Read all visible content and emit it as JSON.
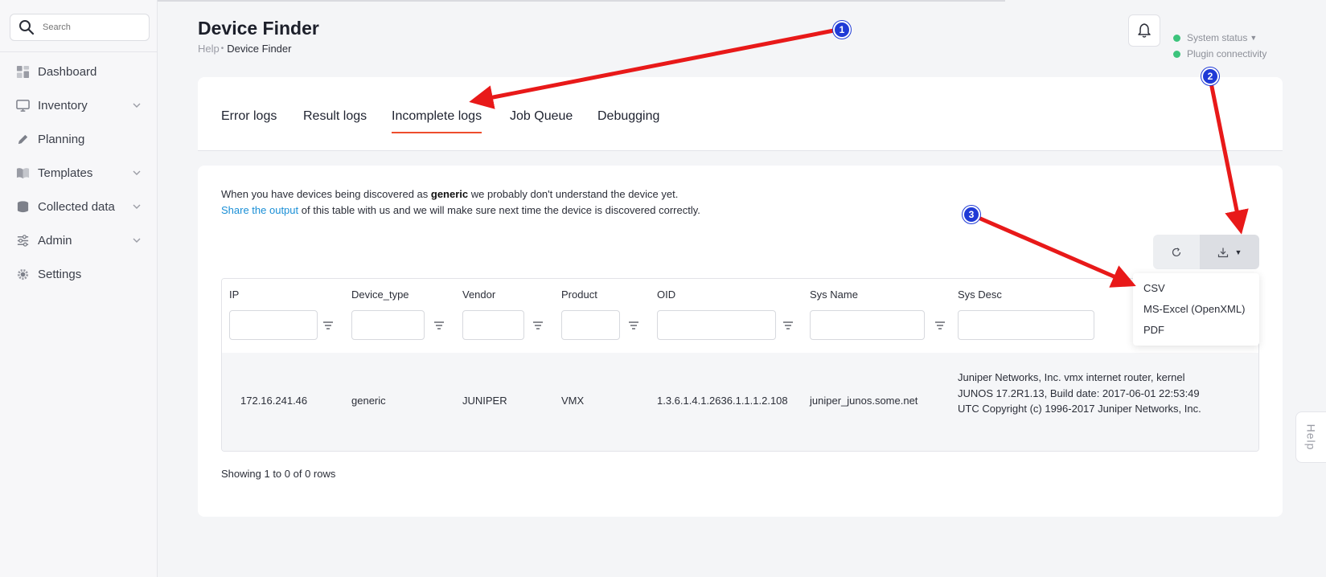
{
  "sidebar": {
    "search_placeholder": "Search",
    "items": [
      {
        "label": "Dashboard",
        "icon": "dashboard-icon",
        "expandable": false
      },
      {
        "label": "Inventory",
        "icon": "monitor-icon",
        "expandable": true
      },
      {
        "label": "Planning",
        "icon": "pencil-icon",
        "expandable": false
      },
      {
        "label": "Templates",
        "icon": "book-icon",
        "expandable": true
      },
      {
        "label": "Collected data",
        "icon": "database-icon",
        "expandable": true
      },
      {
        "label": "Admin",
        "icon": "sliders-icon",
        "expandable": true
      },
      {
        "label": "Settings",
        "icon": "gear-icon",
        "expandable": false
      }
    ]
  },
  "header": {
    "title": "Device Finder",
    "breadcrumb": {
      "parent": "Help",
      "current": "Device Finder"
    },
    "status": {
      "system": "System status",
      "plugin": "Plugin connectivity",
      "indicator_color": "#3cc47c"
    }
  },
  "tabs": [
    {
      "label": "Error logs",
      "active": false
    },
    {
      "label": "Result logs",
      "active": false
    },
    {
      "label": "Incomplete logs",
      "active": true
    },
    {
      "label": "Job Queue",
      "active": false
    },
    {
      "label": "Debugging",
      "active": false
    }
  ],
  "info": {
    "line1_pre": "When you have devices being discovered as ",
    "line1_bold": "generic",
    "line1_post": " we probably don't understand the device yet.",
    "line2_link": "Share the output",
    "line2_post": " of this table with us and we will make sure next time the device is discovered correctly."
  },
  "export_menu": {
    "items": [
      "CSV",
      "MS-Excel (OpenXML)",
      "PDF"
    ]
  },
  "table": {
    "columns": [
      "IP",
      "Device_type",
      "Vendor",
      "Product",
      "OID",
      "Sys Name",
      "Sys Desc"
    ],
    "rows": [
      {
        "ip": "172.16.241.46",
        "device_type": "generic",
        "vendor": "JUNIPER",
        "product": "VMX",
        "oid": "1.3.6.1.4.1.2636.1.1.1.2.108",
        "sys_name": "juniper_junos.some.net",
        "sys_desc": "Juniper Networks, Inc. vmx internet router, kernel JUNOS 17.2R1.13, Build date: 2017-06-01 22:53:49 UTC Copyright (c) 1996-2017 Juniper Networks, Inc."
      }
    ],
    "footer": "Showing 1 to 0 of 0 rows"
  },
  "help_tab": "Help",
  "annotations": {
    "badges": [
      "1",
      "2",
      "3"
    ],
    "arrow_color": "#e81919",
    "badge_color": "#1f3ad6"
  }
}
